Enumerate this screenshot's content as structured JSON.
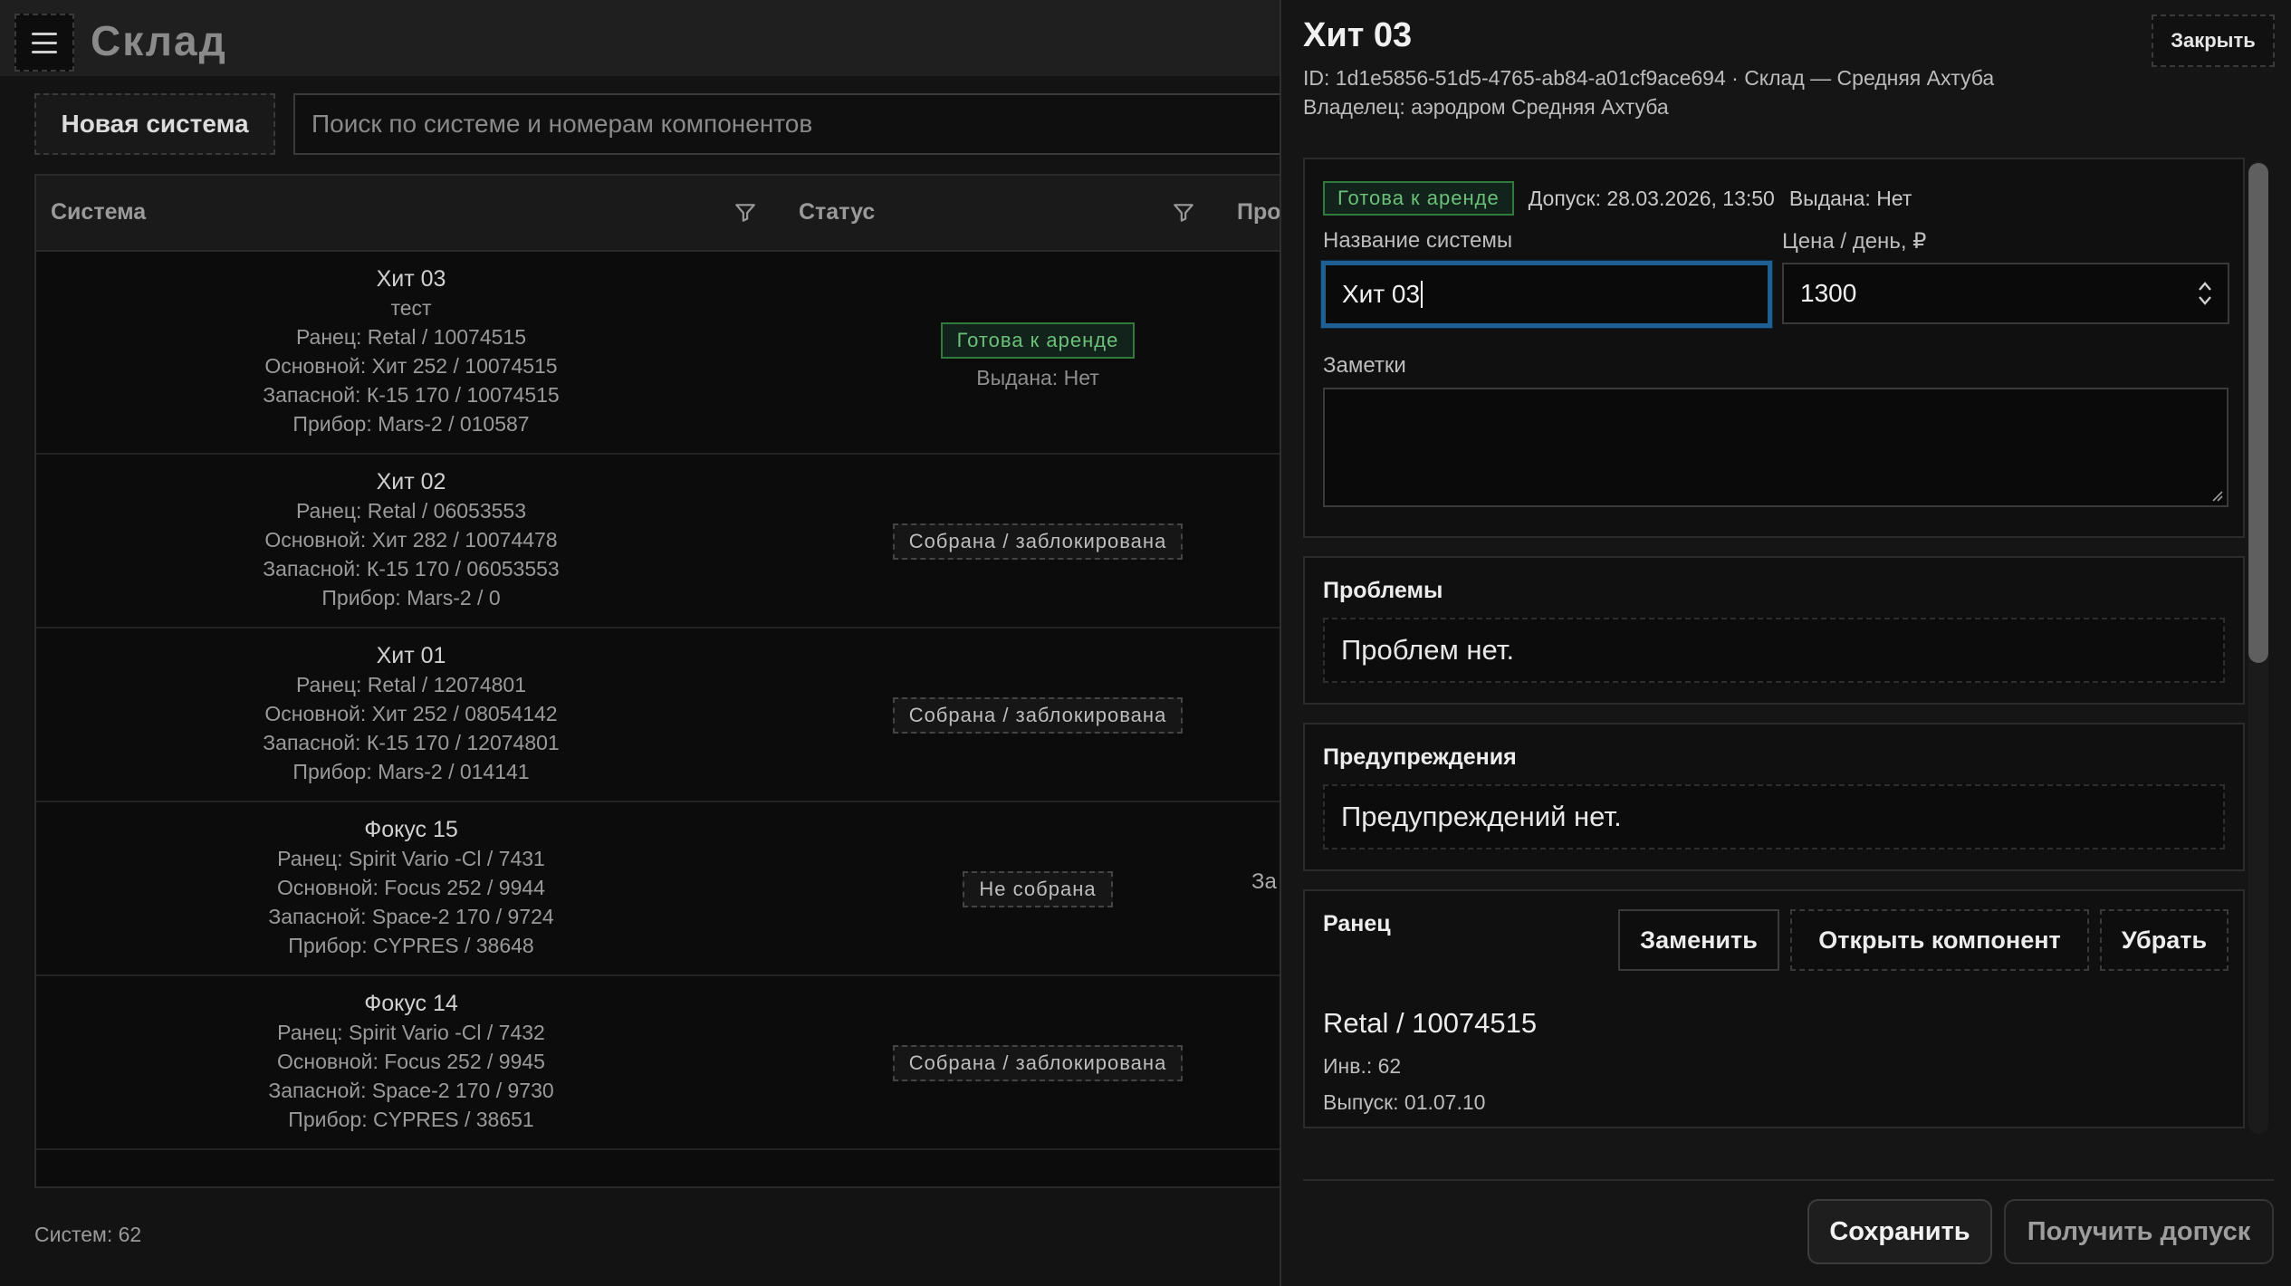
{
  "app": {
    "title": "Склад"
  },
  "toolbar": {
    "new_system_label": "Новая система",
    "search_placeholder": "Поиск по системе и номерам компонентов"
  },
  "table": {
    "columns": [
      "Система",
      "Статус",
      "Про"
    ],
    "rows": [
      {
        "name": "Хит 03",
        "lines": [
          "тест",
          "Ранец: Retal / 10074515",
          "Основной: Хит 252 / 10074515",
          "Запасной: К-15 170 / 10074515",
          "Прибор: Mars-2 / 010587"
        ],
        "status": "Готова к аренде",
        "status_color": "green",
        "issued": "Выдана: Нет",
        "peek": ""
      },
      {
        "name": "Хит 02",
        "lines": [
          "Ранец: Retal / 06053553",
          "Основной: Хит 282 / 10074478",
          "Запасной: К-15 170 / 06053553",
          "Прибор: Mars-2 / 0"
        ],
        "status": "Собрана / заблокирована",
        "status_color": "gray",
        "issued": "",
        "peek": ""
      },
      {
        "name": "Хит 01",
        "lines": [
          "Ранец: Retal / 12074801",
          "Основной: Хит 252 / 08054142",
          "Запасной: К-15 170 / 12074801",
          "Прибор: Mars-2 / 014141"
        ],
        "status": "Собрана / заблокирована",
        "status_color": "gray",
        "issued": "",
        "peek": ""
      },
      {
        "name": "Фокус 15",
        "lines": [
          "Ранец: Spirit Vario -Cl / 7431",
          "Основной: Focus 252 / 9944",
          "Запасной: Space-2 170 / 9724",
          "Прибор: CYPRES / 38648"
        ],
        "status": "Не собрана",
        "status_color": "gray",
        "issued": "",
        "peek": "За"
      },
      {
        "name": "Фокус 14",
        "lines": [
          "Ранец: Spirit Vario -Cl / 7432",
          "Основной: Focus 252 / 9945",
          "Запасной: Space-2 170 / 9730",
          "Прибор: CYPRES / 38651"
        ],
        "status": "Собрана / заблокирована",
        "status_color": "gray",
        "issued": "",
        "peek": ""
      }
    ]
  },
  "footer": {
    "count_label": "Систем: 62"
  },
  "drawer": {
    "title": "Хит 03",
    "meta_line1": "ID: 1d1e5856-51d5-4765-ab84-a01cf9ace694 · Склад — Средняя Ахтуба",
    "meta_line2": "Владелец: аэродром Средняя Ахтуба",
    "close_label": "Закрыть",
    "status_badge": "Готова к аренде",
    "permit_text": "Допуск: 28.03.2026, 13:50",
    "issued_text": "Выдана: Нет",
    "name_label": "Название системы",
    "name_value": "Хит 03",
    "price_label": "Цена / день, ₽",
    "price_value": "1300",
    "notes_label": "Заметки",
    "notes_value": "",
    "problems_title": "Проблемы",
    "problems_text": "Проблем нет.",
    "warnings_title": "Предупреждения",
    "warnings_text": "Предупреждений нет.",
    "component": {
      "title": "Ранец",
      "replace_label": "Заменить",
      "open_label": "Открыть компонент",
      "remove_label": "Убрать",
      "name": "Retal / 10074515",
      "inv": "Инв.: 62",
      "release": "Выпуск: 01.07.10"
    },
    "save_label": "Сохранить",
    "get_permit_label": "Получить допуск"
  },
  "colors": {
    "accent_focus": "#1f5f93",
    "ready_green": "#6cc07a",
    "background": "#131313"
  }
}
